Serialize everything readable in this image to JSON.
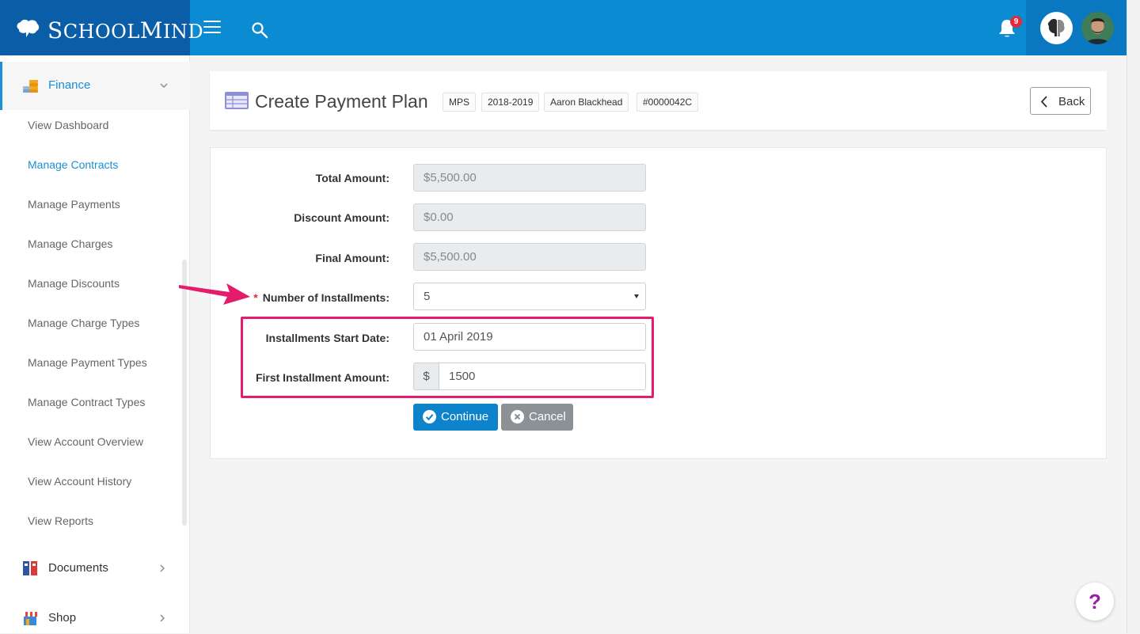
{
  "brand": {
    "name_first_big": "S",
    "name_first_rest": "CHOOL",
    "name_second_big": "M",
    "name_second_rest": "IND"
  },
  "header": {
    "notification_count": "9"
  },
  "sidebar": {
    "finance_label": "Finance",
    "finance_items": [
      "View Dashboard",
      "Manage Contracts",
      "Manage Payments",
      "Manage Charges",
      "Manage Discounts",
      "Manage Charge Types",
      "Manage Payment Types",
      "Manage Contract Types",
      "View Account Overview",
      "View Account History",
      "View Reports"
    ],
    "active_item": "Manage Contracts",
    "documents_label": "Documents",
    "shop_label": "Shop"
  },
  "page": {
    "title": "Create Payment Plan",
    "tags": [
      "MPS",
      "2018-2019",
      "Aaron Blackhead",
      "#0000042C"
    ],
    "back_label": "Back"
  },
  "form": {
    "total_amount_label": "Total Amount:",
    "total_amount_value": "$5,500.00",
    "discount_amount_label": "Discount Amount:",
    "discount_amount_value": "$0.00",
    "final_amount_label": "Final Amount:",
    "final_amount_value": "$5,500.00",
    "required_mark": "*",
    "installments_label": "Number of Installments:",
    "installments_value": "5",
    "start_date_label": "Installments Start Date:",
    "start_date_value": "01 April 2019",
    "first_amount_label": "First Installment Amount:",
    "currency_symbol": "$",
    "first_amount_value": "1500",
    "continue_label": "Continue",
    "cancel_label": "Cancel"
  },
  "help_label": "?",
  "colors": {
    "header_blue": "#0a8bd2",
    "brand_blue": "#0a5ea8",
    "accent": "#1a8fd5",
    "highlight": "#e31c6c",
    "badge_red": "#e5293b",
    "cancel_gray": "#8c9196"
  }
}
